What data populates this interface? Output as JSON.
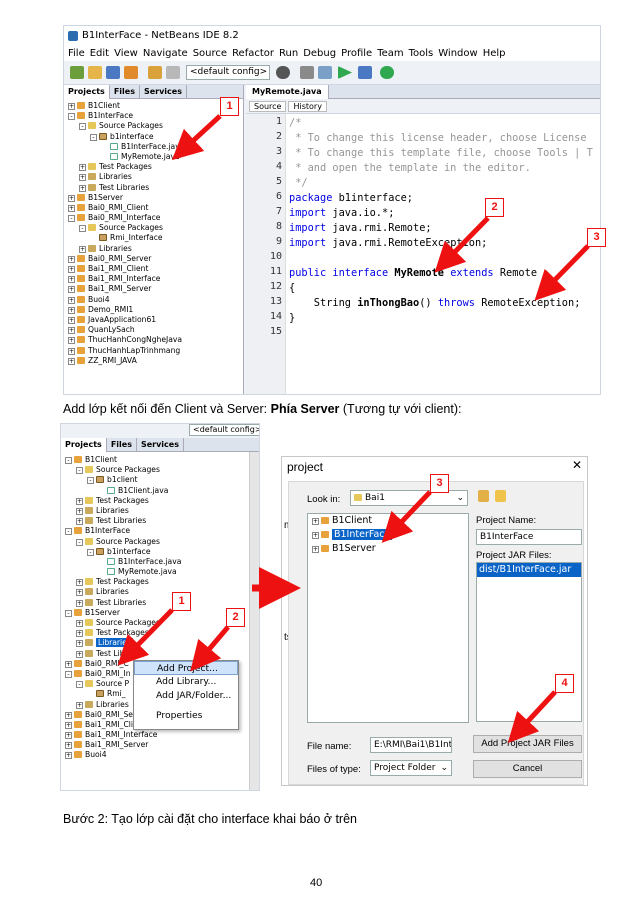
{
  "shot1": {
    "title": "B1InterFace - NetBeans IDE 8.2",
    "menu": [
      "File",
      "Edit",
      "View",
      "Navigate",
      "Source",
      "Refactor",
      "Run",
      "Debug",
      "Profile",
      "Team",
      "Tools",
      "Window",
      "Help"
    ],
    "config": "<default config>",
    "tabs": [
      "Projects",
      "Files",
      "Services"
    ],
    "tree": [
      {
        "t": "B1Client",
        "lvl": 0,
        "ico": "proj",
        "pm": "+"
      },
      {
        "t": "B1InterFace",
        "lvl": 0,
        "ico": "proj",
        "pm": "-"
      },
      {
        "t": "Source Packages",
        "lvl": 1,
        "ico": "folder",
        "pm": "-"
      },
      {
        "t": "b1interface",
        "lvl": 2,
        "ico": "pkg",
        "pm": "-"
      },
      {
        "t": "B1InterFace.java",
        "lvl": 3,
        "ico": "jfile",
        "pm": ""
      },
      {
        "t": "MyRemote.java",
        "lvl": 3,
        "ico": "jfile",
        "pm": ""
      },
      {
        "t": "Test Packages",
        "lvl": 1,
        "ico": "folder",
        "pm": "+"
      },
      {
        "t": "Libraries",
        "lvl": 1,
        "ico": "lib",
        "pm": "+"
      },
      {
        "t": "Test Libraries",
        "lvl": 1,
        "ico": "lib",
        "pm": "+"
      },
      {
        "t": "B1Server",
        "lvl": 0,
        "ico": "proj",
        "pm": "+"
      },
      {
        "t": "Bai0_RMI_Client",
        "lvl": 0,
        "ico": "proj",
        "pm": "+"
      },
      {
        "t": "Bai0_RMI_Interface",
        "lvl": 0,
        "ico": "proj",
        "pm": "-"
      },
      {
        "t": "Source Packages",
        "lvl": 1,
        "ico": "folder",
        "pm": "-"
      },
      {
        "t": "Rmi_Interface",
        "lvl": 2,
        "ico": "pkg",
        "pm": ""
      },
      {
        "t": "Libraries",
        "lvl": 1,
        "ico": "lib",
        "pm": "+"
      },
      {
        "t": "Bai0_RMI_Server",
        "lvl": 0,
        "ico": "proj",
        "pm": "+"
      },
      {
        "t": "Bai1_RMI_Client",
        "lvl": 0,
        "ico": "proj",
        "pm": "+"
      },
      {
        "t": "Bai1_RMI_Interface",
        "lvl": 0,
        "ico": "proj",
        "pm": "+"
      },
      {
        "t": "Bai1_RMI_Server",
        "lvl": 0,
        "ico": "proj",
        "pm": "+"
      },
      {
        "t": "Buoi4",
        "lvl": 0,
        "ico": "proj",
        "pm": "+"
      },
      {
        "t": "Demo_RMI1",
        "lvl": 0,
        "ico": "proj",
        "pm": "+"
      },
      {
        "t": "JavaApplication61",
        "lvl": 0,
        "ico": "proj",
        "pm": "+"
      },
      {
        "t": "QuanLySach",
        "lvl": 0,
        "ico": "proj",
        "pm": "+"
      },
      {
        "t": "ThucHanhCongNgheJava",
        "lvl": 0,
        "ico": "proj",
        "pm": "+"
      },
      {
        "t": "ThucHanhLapTrinhmang",
        "lvl": 0,
        "ico": "proj",
        "pm": "+"
      },
      {
        "t": "ZZ_RMI_JAVA",
        "lvl": 0,
        "ico": "proj",
        "pm": "+"
      }
    ],
    "editor_tab": "MyRemote.java",
    "editor_tools": [
      "Source",
      "History"
    ],
    "line_numbers": [
      "1",
      "2",
      "3",
      "4",
      "5",
      "6",
      "7",
      "8",
      "9",
      "10",
      "11",
      "12",
      "13",
      "14",
      "15"
    ],
    "code": [
      [
        [
          "/*",
          "cmt"
        ]
      ],
      [
        [
          " * To change this license header, choose License",
          "cmt"
        ]
      ],
      [
        [
          " * To change this template file, choose Tools | T",
          "cmt"
        ]
      ],
      [
        [
          " * and open the template in the editor.",
          "cmt"
        ]
      ],
      [
        [
          " */",
          "cmt"
        ]
      ],
      [
        [
          "package",
          "kw"
        ],
        [
          " b1interface;",
          ""
        ]
      ],
      [
        [
          "import",
          "kw"
        ],
        [
          " java.io.*;",
          ""
        ]
      ],
      [
        [
          "import",
          "kw"
        ],
        [
          " java.rmi.Remote;",
          ""
        ]
      ],
      [
        [
          "import",
          "kw"
        ],
        [
          " java.rmi.RemoteException;",
          ""
        ]
      ],
      [
        [
          "",
          ""
        ]
      ],
      [
        [
          "public",
          "kw"
        ],
        [
          " ",
          ""
        ],
        [
          "interface",
          "kw"
        ],
        [
          " ",
          ""
        ],
        [
          "MyRemote",
          "bold"
        ],
        [
          " ",
          ""
        ],
        [
          "extends",
          "kw"
        ],
        [
          " Remote",
          ""
        ]
      ],
      [
        [
          "{",
          ""
        ]
      ],
      [
        [
          "    String ",
          ""
        ],
        [
          "inThongBao",
          "bold"
        ],
        [
          "() ",
          ""
        ],
        [
          "throws",
          "kw"
        ],
        [
          " RemoteException;",
          ""
        ]
      ],
      [
        [
          "}",
          ""
        ]
      ],
      [
        [
          "",
          ""
        ]
      ]
    ]
  },
  "caption1_plain": "Add lớp kết nối đến Client và Server: ",
  "caption1_bold": "Phía Server",
  "caption1_tail": " (Tương tự với client):",
  "shot2": {
    "tabs": [
      "Projects",
      "Files",
      "Services"
    ],
    "config": "<default config>",
    "tree": [
      {
        "t": "B1Client",
        "lvl": 0,
        "ico": "proj",
        "pm": "-"
      },
      {
        "t": "Source Packages",
        "lvl": 1,
        "ico": "folder",
        "pm": "-"
      },
      {
        "t": "b1client",
        "lvl": 2,
        "ico": "pkg",
        "pm": "-"
      },
      {
        "t": "B1Client.java",
        "lvl": 3,
        "ico": "jfile",
        "pm": ""
      },
      {
        "t": "Test Packages",
        "lvl": 1,
        "ico": "folder",
        "pm": "+"
      },
      {
        "t": "Libraries",
        "lvl": 1,
        "ico": "lib",
        "pm": "+"
      },
      {
        "t": "Test Libraries",
        "lvl": 1,
        "ico": "lib",
        "pm": "+"
      },
      {
        "t": "B1InterFace",
        "lvl": 0,
        "ico": "proj",
        "pm": "-"
      },
      {
        "t": "Source Packages",
        "lvl": 1,
        "ico": "folder",
        "pm": "-"
      },
      {
        "t": "b1interface",
        "lvl": 2,
        "ico": "pkg",
        "pm": "-"
      },
      {
        "t": "B1InterFace.java",
        "lvl": 3,
        "ico": "jfile",
        "pm": ""
      },
      {
        "t": "MyRemote.java",
        "lvl": 3,
        "ico": "jfile",
        "pm": ""
      },
      {
        "t": "Test Packages",
        "lvl": 1,
        "ico": "folder",
        "pm": "+"
      },
      {
        "t": "Libraries",
        "lvl": 1,
        "ico": "lib",
        "pm": "+"
      },
      {
        "t": "Test Libraries",
        "lvl": 1,
        "ico": "lib",
        "pm": "+"
      },
      {
        "t": "B1Server",
        "lvl": 0,
        "ico": "proj",
        "pm": "-"
      },
      {
        "t": "Source Packages",
        "lvl": 1,
        "ico": "folder",
        "pm": "+"
      },
      {
        "t": "Test Packages",
        "lvl": 1,
        "ico": "folder",
        "pm": "+"
      },
      {
        "t": "Libraries",
        "lvl": 1,
        "ico": "lib",
        "pm": "+",
        "sel": true
      },
      {
        "t": "Test Libr",
        "lvl": 1,
        "ico": "lib",
        "pm": "+"
      },
      {
        "t": "Bai0_RMI_C",
        "lvl": 0,
        "ico": "proj",
        "pm": "+"
      },
      {
        "t": "Bai0_RMI_In",
        "lvl": 0,
        "ico": "proj",
        "pm": "-"
      },
      {
        "t": "Source P",
        "lvl": 1,
        "ico": "folder",
        "pm": "-"
      },
      {
        "t": "Rmi_",
        "lvl": 2,
        "ico": "pkg",
        "pm": ""
      },
      {
        "t": "Libraries",
        "lvl": 1,
        "ico": "lib",
        "pm": "+"
      },
      {
        "t": "Bai0_RMI_Server",
        "lvl": 0,
        "ico": "proj",
        "pm": "+"
      },
      {
        "t": "Bai1_RMI_Client",
        "lvl": 0,
        "ico": "proj",
        "pm": "+"
      },
      {
        "t": "Bai1_RMI_Interface",
        "lvl": 0,
        "ico": "proj",
        "pm": "+"
      },
      {
        "t": "Bai1_RMI_Server",
        "lvl": 0,
        "ico": "proj",
        "pm": "+"
      },
      {
        "t": "Buoi4",
        "lvl": 0,
        "ico": "proj",
        "pm": "+"
      }
    ],
    "context_menu": [
      "Add Project...",
      "Add Library...",
      "Add JAR/Folder...",
      "Properties"
    ]
  },
  "dialog": {
    "title": "project",
    "close": "✕",
    "side_labels": [
      "ms",
      "ts"
    ],
    "look_in_label": "Look in:",
    "look_in_value": "Bai1",
    "files": [
      "B1Client",
      "B1InterFace",
      "B1Server"
    ],
    "project_name_label": "Project Name:",
    "project_name": "B1InterFace",
    "jar_label": "Project JAR Files:",
    "jar_file": "dist/B1InterFace.jar",
    "file_name_label": "File name:",
    "file_name": "E:\\RMI\\Bai1\\B1Inte",
    "files_of_type_label": "Files of type:",
    "files_of_type": "Project Folder",
    "add_button": "Add Project JAR Files",
    "cancel_button": "Cancel"
  },
  "badges": [
    "1",
    "2",
    "3",
    "1",
    "2",
    "3",
    "4"
  ],
  "caption2": "Bước 2: Tạo lớp cài đặt cho interface khai báo ở trên",
  "page_number": "40",
  "colors": {
    "accent_red": "#e11",
    "selection": "#0a64c8",
    "keyword": "#0000e6",
    "comment": "#969696"
  }
}
